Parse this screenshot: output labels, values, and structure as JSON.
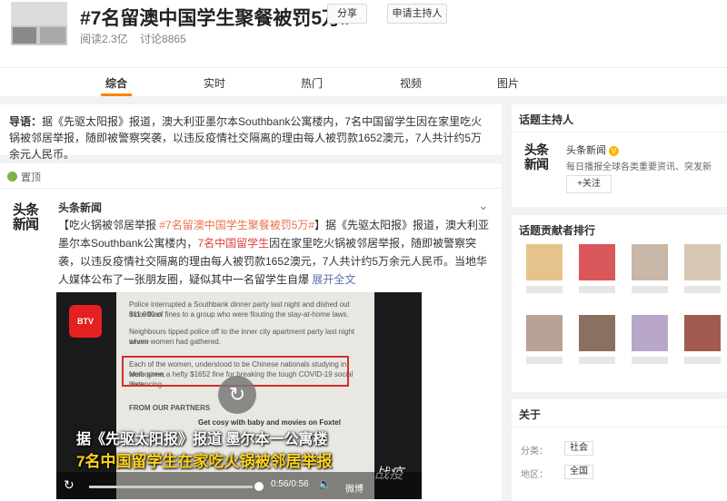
{
  "header": {
    "title": "#7名留澳中国学生聚餐被罚5万#",
    "reads": "阅读2.3亿",
    "discussions": "讨论8865",
    "share_label": "分享",
    "apply_host_label": "申请主持人"
  },
  "tabs": [
    {
      "label": "综合",
      "active": true
    },
    {
      "label": "实时",
      "active": false
    },
    {
      "label": "热门",
      "active": false
    },
    {
      "label": "视频",
      "active": false
    },
    {
      "label": "图片",
      "active": false
    }
  ],
  "intro": {
    "prefix": "导语：",
    "text": "据《先驱太阳报》报道，澳大利亚墨尔本Southbank公寓楼内，7名中国留学生因在家里吃火锅被邻居举报，随即被警察突袭，以违反疫情社交隔离的理由每人被罚款1652澳元，7人共计约5万余元人民币。"
  },
  "pinned": {
    "label": "置顶",
    "author": "头条新闻",
    "avatar_text": "头条新闻",
    "segments": [
      {
        "text": "【吃火锅被邻居举报 ",
        "style": "plain"
      },
      {
        "text": "#7名留澳中国学生聚餐被罚5万#",
        "style": "tag"
      },
      {
        "text": "】据《先驱太阳报》报道，澳大利亚墨尔本Southbank公寓楼内，",
        "style": "plain"
      },
      {
        "text": "7名中国留学生",
        "style": "red"
      },
      {
        "text": "因在家里吃火锅被邻居举报，随即被警察突袭，以违反疫情社交隔离的理由每人被罚款1652澳元，7人共计约5万余元人民币。当地华人媒体公布了一张朋友圈，疑似其中一名留学生自爆",
        "style": "plain"
      },
      {
        "text": " 展开全文",
        "style": "expand"
      }
    ],
    "expand_icon": "chevron-down-icon"
  },
  "video": {
    "logo_text": "BTV",
    "paper_lines": [
      "Police interrupted a Southbank dinner party last night and dished out more than",
      "$11,000 of fines to a group who were flouting the stay-at-home laws.",
      "Neighbours tipped police off to the inner city apartment party last night where",
      "seven women had gathered.",
      "Each of the women, understood to be Chinese nationals studying in Melbourne,",
      "were given a hefty $1652 fine for breaking the tough COVID-19 social distancing",
      "laws.",
      "FROM OUR PARTNERS",
      "Get cosy with baby and movies on Foxtel"
    ],
    "subtitle_line1": "据《先驱太阳报》报道 墨尔本一公寓楼",
    "subtitle_line2": "7名中国留学生在家吃火锅被邻居举报",
    "time": "0:56/0:56",
    "progress": 1.0,
    "watermark": "微博",
    "watermark2": "战疫"
  },
  "sidebar": {
    "host_title": "话题主持人",
    "host_name": "头条新闻",
    "host_desc": "每日播报全球各类重要资讯、突发新",
    "follow_label": "+关注",
    "rank_title": "话题贡献者排行",
    "about_title": "关于",
    "category_label": "分类：",
    "category_value": "社会",
    "region_label": "地区：",
    "region_value": "全国"
  },
  "colors": {
    "accent": "#ff8200",
    "tag": "#eb7350",
    "red": "#e03e36",
    "link": "#5d6fa8"
  }
}
